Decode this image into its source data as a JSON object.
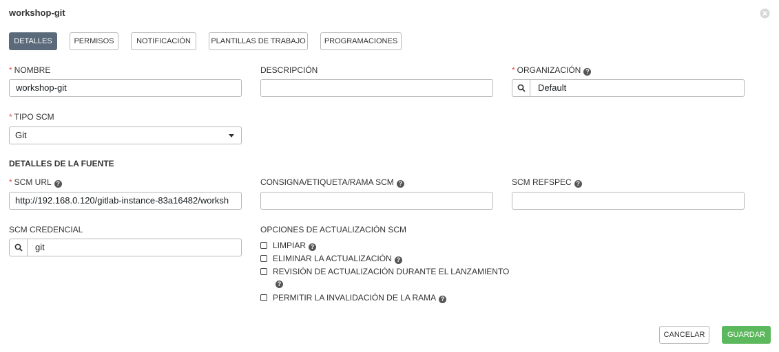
{
  "header": {
    "title": "workshop-git"
  },
  "tabs": [
    {
      "label": "DETALLES",
      "active": true
    },
    {
      "label": "PERMISOS",
      "active": false
    },
    {
      "label": "NOTIFICACIÓN",
      "active": false
    },
    {
      "label": "PLANTILLAS DE TRABAJO",
      "active": false
    },
    {
      "label": "PROGRAMACIONES",
      "active": false
    }
  ],
  "required_marker": "*",
  "help_glyph": "?",
  "fields": {
    "nombre": {
      "label": "NOMBRE",
      "value": "workshop-git"
    },
    "descripcion": {
      "label": "DESCRIPCIÓN",
      "value": ""
    },
    "organizacion": {
      "label": "ORGANIZACIÓN",
      "value": "Default"
    },
    "tipo_scm": {
      "label": "TIPO SCM",
      "value": "Git"
    },
    "scm_url": {
      "label": "SCM URL",
      "value": "http://192.168.0.120/gitlab-instance-83a16482/worksh"
    },
    "scm_branch": {
      "label": "CONSIGNA/ETIQUETA/RAMA SCM",
      "value": ""
    },
    "scm_refspec": {
      "label": "SCM REFSPEC",
      "value": ""
    },
    "scm_credencial": {
      "label": "SCM CREDENCIAL",
      "value": "git"
    }
  },
  "source_details": {
    "title": "DETALLES DE LA FUENTE"
  },
  "update_options": {
    "title": "OPCIONES DE ACTUALIZACIÓN SCM",
    "items": [
      {
        "label": "LIMPIAR",
        "checked": false
      },
      {
        "label": "ELIMINAR LA ACTUALIZACIÓN",
        "checked": false
      },
      {
        "label": "REVISIÓN DE ACTUALIZACIÓN DURANTE EL LANZAMIENTO",
        "checked": false
      },
      {
        "label": "PERMITIR LA INVALIDACIÓN DE LA RAMA",
        "checked": false
      }
    ]
  },
  "actions": {
    "cancel_label": "CANCELAR",
    "save_label": "GUARDAR"
  },
  "colors": {
    "active_tab": "#5a6a7a",
    "save_button": "#5cb85c",
    "required": "#d9534f"
  }
}
